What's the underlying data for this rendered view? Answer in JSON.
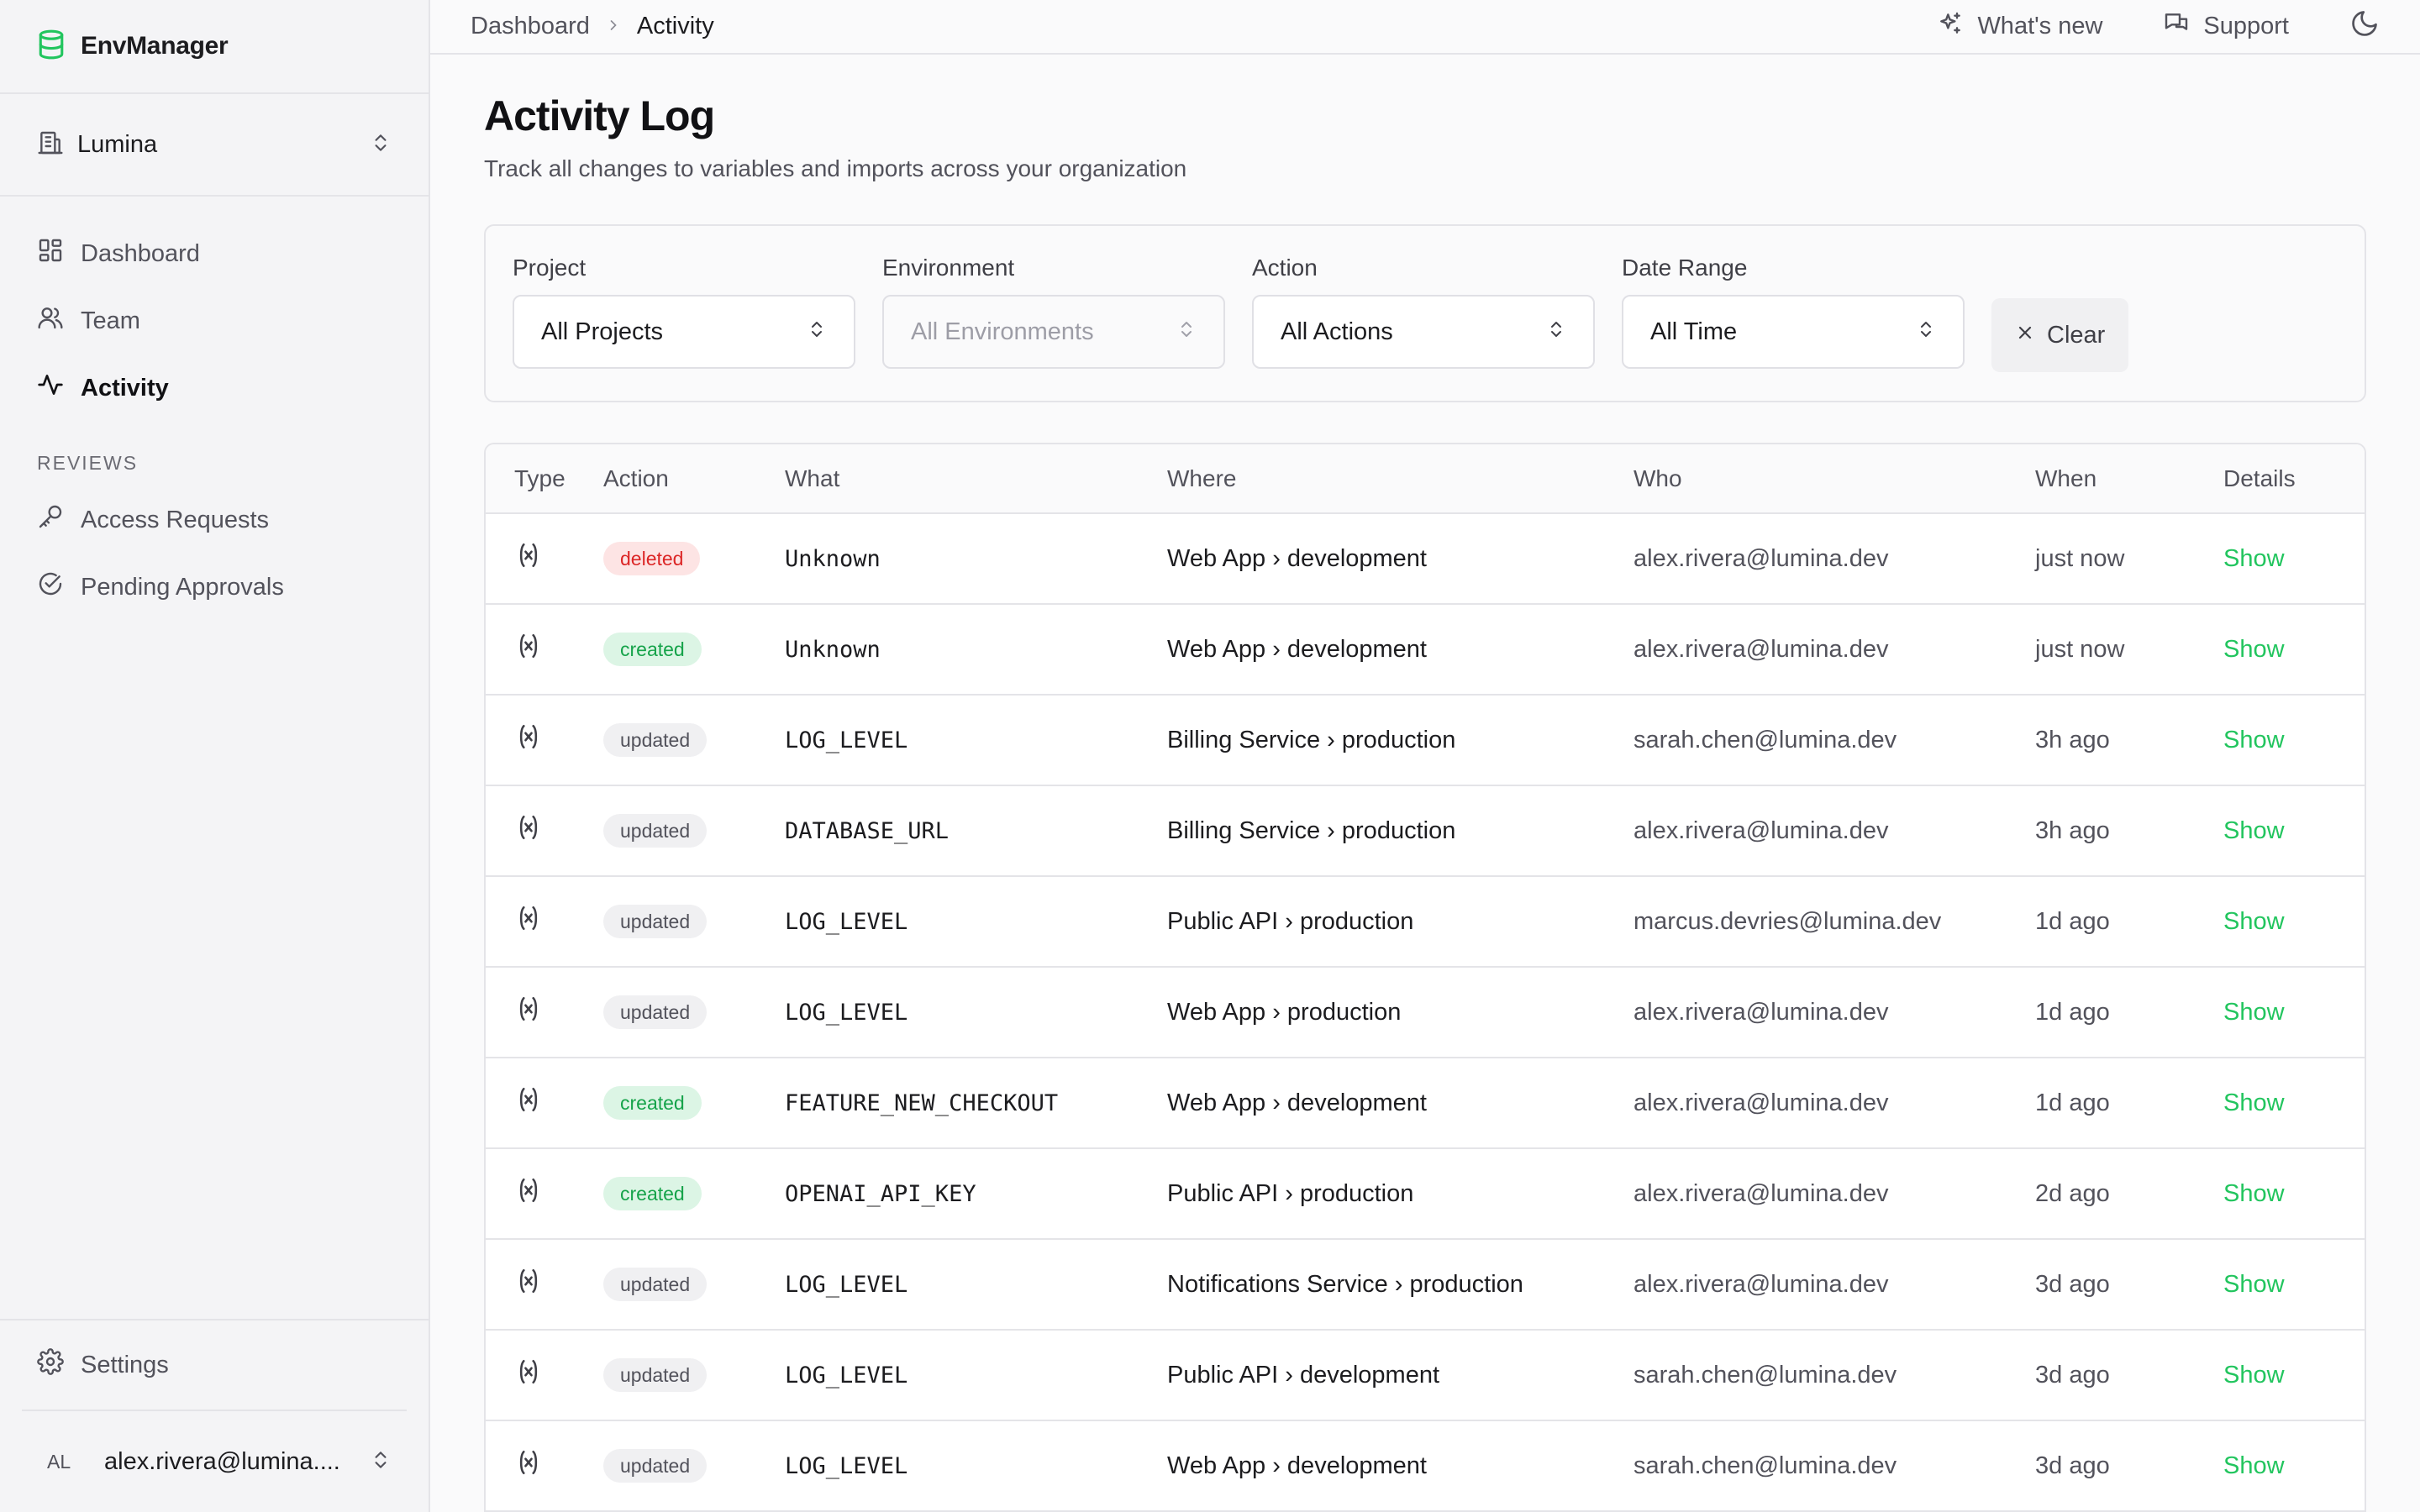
{
  "app": {
    "name": "EnvManager",
    "accent": "#22c55e"
  },
  "org": {
    "name": "Lumina"
  },
  "sidebar": {
    "items": [
      {
        "label": "Dashboard",
        "icon": "dashboard-icon",
        "active": false
      },
      {
        "label": "Team",
        "icon": "users-icon",
        "active": false
      },
      {
        "label": "Activity",
        "icon": "activity-icon",
        "active": true
      }
    ],
    "reviews_section": "REVIEWS",
    "review_items": [
      {
        "label": "Access Requests",
        "icon": "key-icon"
      },
      {
        "label": "Pending Approvals",
        "icon": "check-circle-icon"
      }
    ],
    "settings_label": "Settings",
    "user": {
      "initials": "AL",
      "email": "alex.rivera@lumina...."
    }
  },
  "topbar": {
    "breadcrumb": [
      "Dashboard",
      "Activity"
    ],
    "whats_new": "What's new",
    "support": "Support"
  },
  "page": {
    "title": "Activity Log",
    "subtitle": "Track all changes to variables and imports across your organization"
  },
  "filters": {
    "project": {
      "label": "Project",
      "value": "All Projects"
    },
    "environment": {
      "label": "Environment",
      "value": "All Environments"
    },
    "action": {
      "label": "Action",
      "value": "All Actions"
    },
    "date_range": {
      "label": "Date Range",
      "value": "All Time"
    },
    "clear_label": "Clear"
  },
  "table": {
    "columns": [
      "Type",
      "Action",
      "What",
      "Where",
      "Who",
      "When",
      "Details"
    ],
    "rows": [
      {
        "action": "deleted",
        "what": "Unknown",
        "where": "Web App › development",
        "who": "alex.rivera@lumina.dev",
        "when": "just now",
        "details": "Show"
      },
      {
        "action": "created",
        "what": "Unknown",
        "where": "Web App › development",
        "who": "alex.rivera@lumina.dev",
        "when": "just now",
        "details": "Show"
      },
      {
        "action": "updated",
        "what": "LOG_LEVEL",
        "where": "Billing Service › production",
        "who": "sarah.chen@lumina.dev",
        "when": "3h ago",
        "details": "Show"
      },
      {
        "action": "updated",
        "what": "DATABASE_URL",
        "where": "Billing Service › production",
        "who": "alex.rivera@lumina.dev",
        "when": "3h ago",
        "details": "Show"
      },
      {
        "action": "updated",
        "what": "LOG_LEVEL",
        "where": "Public API › production",
        "who": "marcus.devries@lumina.dev",
        "when": "1d ago",
        "details": "Show"
      },
      {
        "action": "updated",
        "what": "LOG_LEVEL",
        "where": "Web App › production",
        "who": "alex.rivera@lumina.dev",
        "when": "1d ago",
        "details": "Show"
      },
      {
        "action": "created",
        "what": "FEATURE_NEW_CHECKOUT",
        "where": "Web App › development",
        "who": "alex.rivera@lumina.dev",
        "when": "1d ago",
        "details": "Show"
      },
      {
        "action": "created",
        "what": "OPENAI_API_KEY",
        "where": "Public API › production",
        "who": "alex.rivera@lumina.dev",
        "when": "2d ago",
        "details": "Show"
      },
      {
        "action": "updated",
        "what": "LOG_LEVEL",
        "where": "Notifications Service › production",
        "who": "alex.rivera@lumina.dev",
        "when": "3d ago",
        "details": "Show"
      },
      {
        "action": "updated",
        "what": "LOG_LEVEL",
        "where": "Public API › development",
        "who": "sarah.chen@lumina.dev",
        "when": "3d ago",
        "details": "Show"
      },
      {
        "action": "updated",
        "what": "LOG_LEVEL",
        "where": "Web App › development",
        "who": "sarah.chen@lumina.dev",
        "when": "3d ago",
        "details": "Show"
      }
    ]
  }
}
